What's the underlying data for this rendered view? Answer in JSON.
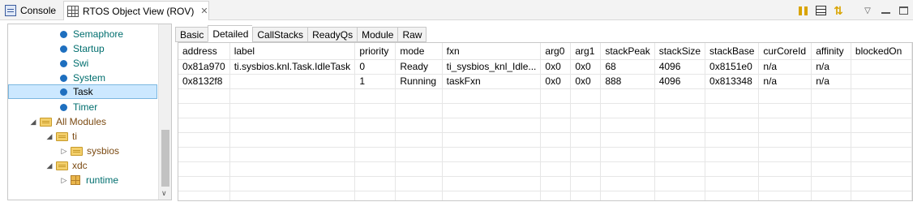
{
  "view_tabs": {
    "console_label": "Console",
    "rov_label": "RTOS Object View (ROV)",
    "close_glyph": "✕"
  },
  "toolbar": {
    "icons": [
      "pause-icon",
      "table-icon",
      "sync-icon",
      "view-menu-icon",
      "minimize-icon",
      "maximize-icon"
    ]
  },
  "tree": {
    "items": [
      {
        "label": "Semaphore",
        "kind": "module"
      },
      {
        "label": "Startup",
        "kind": "module"
      },
      {
        "label": "Swi",
        "kind": "module"
      },
      {
        "label": "System",
        "kind": "module"
      },
      {
        "label": "Task",
        "kind": "module",
        "selected": true
      },
      {
        "label": "Timer",
        "kind": "module"
      },
      {
        "label": "All Modules",
        "kind": "folder",
        "expanded": true
      },
      {
        "label": "ti",
        "kind": "folder",
        "expanded": true
      },
      {
        "label": "sysbios",
        "kind": "folder",
        "expanded": false
      },
      {
        "label": "xdc",
        "kind": "folder",
        "expanded": true
      },
      {
        "label": "runtime",
        "kind": "package",
        "expanded": false
      }
    ],
    "expanded_glyph": "◢",
    "collapsed_glyph": "▷",
    "scroll_down_glyph": "∨"
  },
  "subtabs": {
    "items": [
      "Basic",
      "Detailed",
      "CallStacks",
      "ReadyQs",
      "Module",
      "Raw"
    ],
    "active": "Detailed"
  },
  "table": {
    "columns": [
      "address",
      "label",
      "priority",
      "mode",
      "fxn",
      "arg0",
      "arg1",
      "stackPeak",
      "stackSize",
      "stackBase",
      "curCoreId",
      "affinity",
      "blockedOn"
    ],
    "rows": [
      [
        "0x81a970",
        "ti.sysbios.knl.Task.IdleTask",
        "0",
        "Ready",
        "ti_sysbios_knl_Idle...",
        "0x0",
        "0x0",
        "68",
        "4096",
        "0x8151e0",
        "n/a",
        "n/a",
        ""
      ],
      [
        "0x8132f8",
        "",
        "1",
        "Running",
        "taskFxn",
        "0x0",
        "0x0",
        "888",
        "4096",
        "0x813348",
        "n/a",
        "n/a",
        ""
      ]
    ]
  },
  "colors": {
    "selection": "#cce8ff",
    "tree_label": "#006e6e",
    "folder_label": "#7b4a12",
    "module_dot": "#1e6fbf"
  }
}
